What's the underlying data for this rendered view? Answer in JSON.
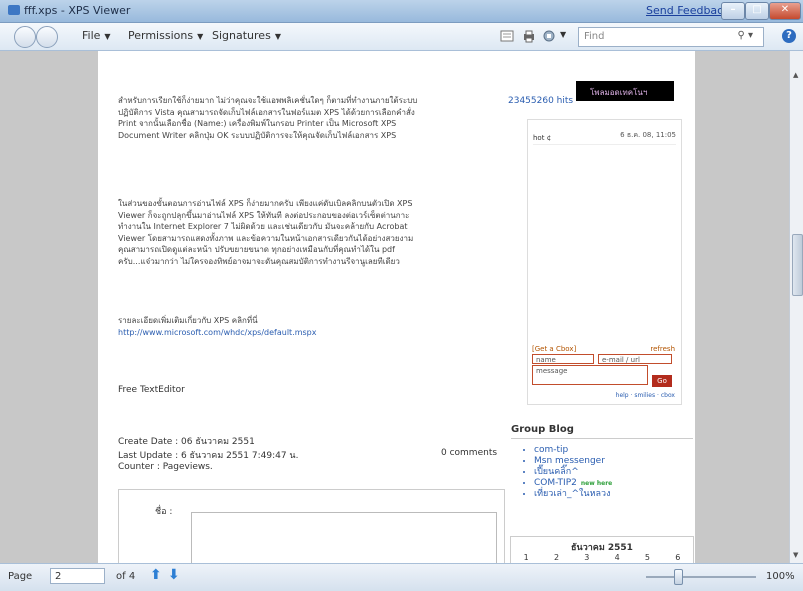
{
  "window": {
    "title": "fff.xps - XPS Viewer",
    "feedback_link": "Send Feedback"
  },
  "toolbar": {
    "menus": [
      "File",
      "Permissions",
      "Signatures"
    ],
    "find_placeholder": "Find",
    "icons": [
      "view-icon",
      "print-icon",
      "permissions-icon",
      "search-icon",
      "help-icon"
    ]
  },
  "document": {
    "paragraph1": "สำหรับการเรียกใช้ก็ง่ายมาก ไม่ว่าคุณจะใช้แอพพลิเคชั่นใดๆ ก็ตามที่ทำงานภายใต้ระบบปฏิบัติการ Vista คุณสามารถจัดเก็บไฟล์เอกสารในฟอร์แมต XPS ได้ด้วยการเลือกคำสั่ง Print จากนั้นเลือกชื่อ (Name:) เครื่องพิมพ์ในกรอบ Printer เป็น Microsoft XPS Document Writer คลิกปุ่ม OK ระบบปฏิบัติการจะให้คุณจัดเก็บไฟล์เอกสาร XPS",
    "paragraph2": "ในส่วนของขั้นตอนการอ่านไฟล์ XPS ก็ง่ายมากครับ เพียงแค่ดับเบิลคลิกบนตัวเปิด XPS Viewer ก็จะถูกปลุกขึ้นมาอ่านไฟล์ XPS ให้ทันที ลงต่อประกอบของต่อเวร์เซ็ตต่านกาะทำงานใน Internet Explorer 7 ไม่ผิดด้วย และเช่นเดียวกับ มันจะคล้ายกับ Acrobat Viewer โดยสามารถแสดงทั้งภาพ และข้อความในหน้าเอกสารเดียวกันได้อย่างสวยงาม คุณสามารถเปิดดูแต่ละหน้า ปรับขยายขนาด ทุกอย่างเหมือนกับที่คุณทำได้ใน pdf ครับ...แจ๋วมากว่า ไม่ใครจองทิพย์อาจมาจะดันคุณสมบัติการทำงานรีจานูเลยทีเดียว",
    "more_text": "รายละเอียดเพิ่มเติมเกี่ยวกับ XPS คลิกที่นี่",
    "more_link": "http://www.microsoft.com/whdc/xps/default.mspx",
    "free_text_editor": "Free TextEditor",
    "create_date": "Create Date : 06 ธันวาคม 2551",
    "last_update": "Last Update : 6 ธันวาคม 2551 7:49:47 น.",
    "counter": "Counter : Pageviews.",
    "comments": "0 comments",
    "comment_label": "ชื่อ :"
  },
  "sidebar": {
    "hits": "23455260 hits",
    "banner": "โพลมอดเทคโนฯ",
    "cbox": {
      "msg_name": "hot ¢",
      "msg_date": "6 ธ.ค. 08, 11:05",
      "get_cbox": "[Get a Cbox]",
      "refresh": "refresh",
      "name_placeholder": "name",
      "email_placeholder": "e-mail / url",
      "message_placeholder": "message",
      "go": "Go",
      "links": "help · smilies · cbox"
    },
    "group_blog_title": "Group Blog",
    "group_blog": [
      "com-tip",
      "Msn messenger",
      "เปี๊ยนคลิ๊ก^",
      "COM-TIP2",
      "เที่ยวเล่า_^ในหลวง"
    ],
    "new_badge": "new here",
    "calendar_month": "ธันวาคม 2551",
    "calendar_days": [
      "1",
      "2",
      "3",
      "4",
      "5",
      "6"
    ]
  },
  "statusbar": {
    "page_label": "Page",
    "page_value": "2",
    "of_pages": "of 4",
    "zoom": "100%"
  }
}
